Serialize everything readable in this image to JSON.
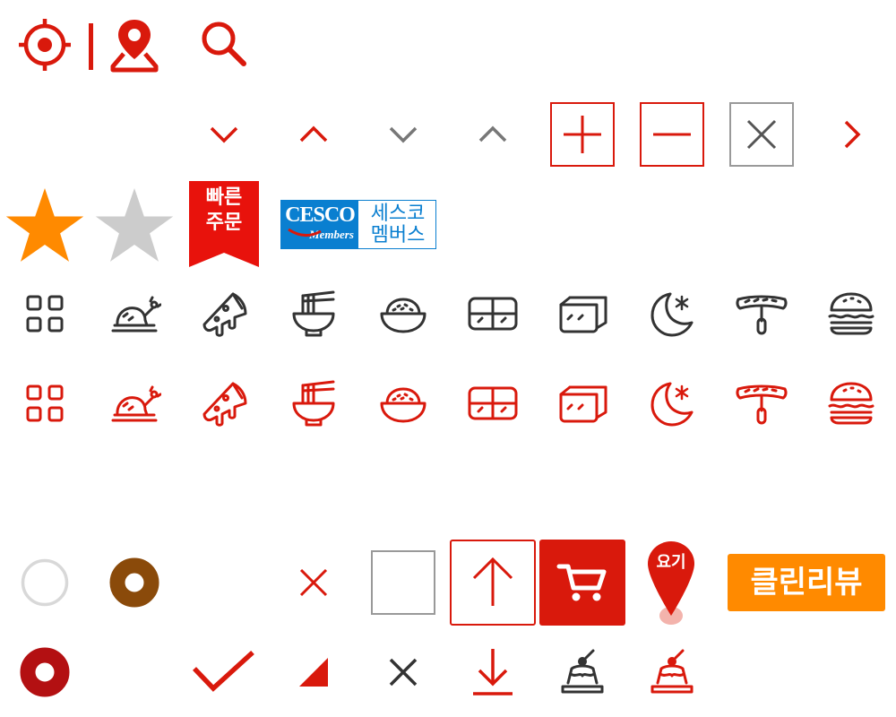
{
  "colors": {
    "red": "#d9190c",
    "dark": "#333333",
    "gray": "#777777",
    "light_gray": "#cccccc",
    "orange": "#ff8a00",
    "brown": "#8a4a0a",
    "dark_red": "#b31012",
    "cesco_blue": "#0a7fd0",
    "white": "#ffffff"
  },
  "labels": {
    "quick_order_line1": "빠른",
    "quick_order_line2": "주문",
    "cesco_brand": "CESCO",
    "cesco_members": "Members",
    "cesco_text_line1": "세스코",
    "cesco_text_line2": "멤버스",
    "map_pin_label": "요기",
    "clean_review": "클린리뷰"
  },
  "icons": [
    "locate-icon",
    "map-pin-icon",
    "search-icon",
    "chevron-down-icon",
    "chevron-up-icon",
    "plus-box-icon",
    "minus-box-icon",
    "close-box-icon",
    "chevron-right-icon",
    "star-filled-icon",
    "star-empty-icon",
    "category-all-icon",
    "chicken-icon",
    "pizza-icon",
    "noodle-icon",
    "rice-bowl-icon",
    "lunchbox-icon",
    "side-dish-icon",
    "late-night-icon",
    "hot-dog-icon",
    "burger-icon",
    "radio-empty-icon",
    "radio-checked-icon",
    "close-icon",
    "checkbox-icon",
    "scroll-top-icon",
    "cart-icon",
    "checkmark-icon",
    "corner-triangle-icon",
    "download-icon",
    "dessert-icon"
  ]
}
